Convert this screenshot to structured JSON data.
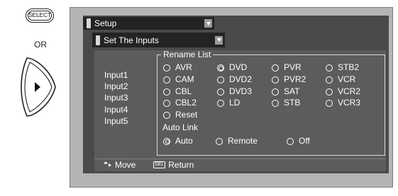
{
  "left_panel": {
    "select_label": "SELECT",
    "or_label": "OR"
  },
  "menu": {
    "title": "Setup",
    "submenu": "Set The Inputs"
  },
  "inputs": [
    "Input1",
    "Input2",
    "Input3",
    "Input4",
    "Input5"
  ],
  "rename_list": {
    "title": "Rename List",
    "options": [
      [
        "AVR",
        "DVD",
        "PVR",
        "STB2"
      ],
      [
        "CAM",
        "DVD2",
        "PVR2",
        "VCR"
      ],
      [
        "CBL",
        "DVD3",
        "SAT",
        "VCR2"
      ],
      [
        "CBL2",
        "LD",
        "STB",
        "VCR3"
      ],
      [
        "Reset"
      ]
    ],
    "selected": "DVD"
  },
  "auto_link": {
    "title": "Auto Link",
    "options": [
      "Auto",
      "Remote",
      "Off"
    ],
    "selected": "Auto"
  },
  "footer": {
    "move": "Move",
    "sel_icon": "SEL",
    "return": "Return"
  },
  "colors": {
    "screen_bg": "#b4b4b4",
    "inner_bg": "#4a4a4a",
    "panel_bg": "#5c5c5c",
    "bar_bg": "#232323"
  }
}
